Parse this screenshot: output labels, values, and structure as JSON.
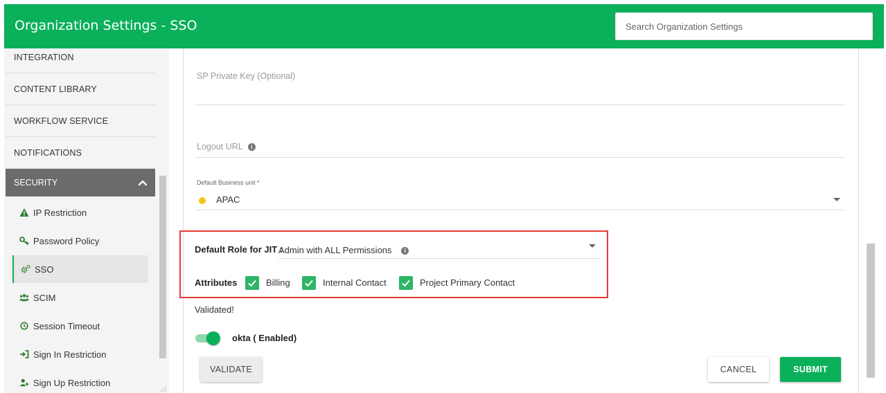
{
  "header": {
    "title": "Organization Settings - SSO",
    "search_placeholder": "Search Organization Settings"
  },
  "sidebar": {
    "items": [
      {
        "label": "INTEGRATION"
      },
      {
        "label": "CONTENT LIBRARY"
      },
      {
        "label": "WORKFLOW SERVICE"
      },
      {
        "label": "NOTIFICATIONS"
      }
    ],
    "security": {
      "label": "SECURITY",
      "expanded": true,
      "subitems": [
        {
          "label": "IP Restriction",
          "icon": "warning-icon"
        },
        {
          "label": "Password Policy",
          "icon": "key-icon"
        },
        {
          "label": "SSO",
          "icon": "gears-icon",
          "active": true
        },
        {
          "label": "SCIM",
          "icon": "users-icon"
        },
        {
          "label": "Session Timeout",
          "icon": "clock-icon"
        },
        {
          "label": "Sign In Restriction",
          "icon": "sign-in-icon"
        },
        {
          "label": "Sign Up Restriction",
          "icon": "user-plus-icon"
        }
      ]
    }
  },
  "form": {
    "sp_private_key_label": "SP Private Key (Optional)",
    "logout_url_label": "Logout URL",
    "default_bu_label": "Default Business unit *",
    "default_bu_value": "APAC",
    "jit_label": "Default Role for JIT :",
    "jit_value": "Admin with ALL Permissions",
    "attributes_label": "Attributes",
    "attributes": [
      {
        "label": "Billing",
        "checked": true
      },
      {
        "label": "Internal Contact",
        "checked": true
      },
      {
        "label": "Project Primary Contact",
        "checked": true
      }
    ],
    "validated_text": "Validated!",
    "toggle_label": "okta ( Enabled)",
    "toggle_on": true
  },
  "buttons": {
    "validate": "VALIDATE",
    "cancel": "CANCEL",
    "submit": "SUBMIT"
  },
  "colors": {
    "brand_green": "#0bb05a",
    "highlight_red": "#e53935",
    "bu_dot": "#f5c518"
  }
}
